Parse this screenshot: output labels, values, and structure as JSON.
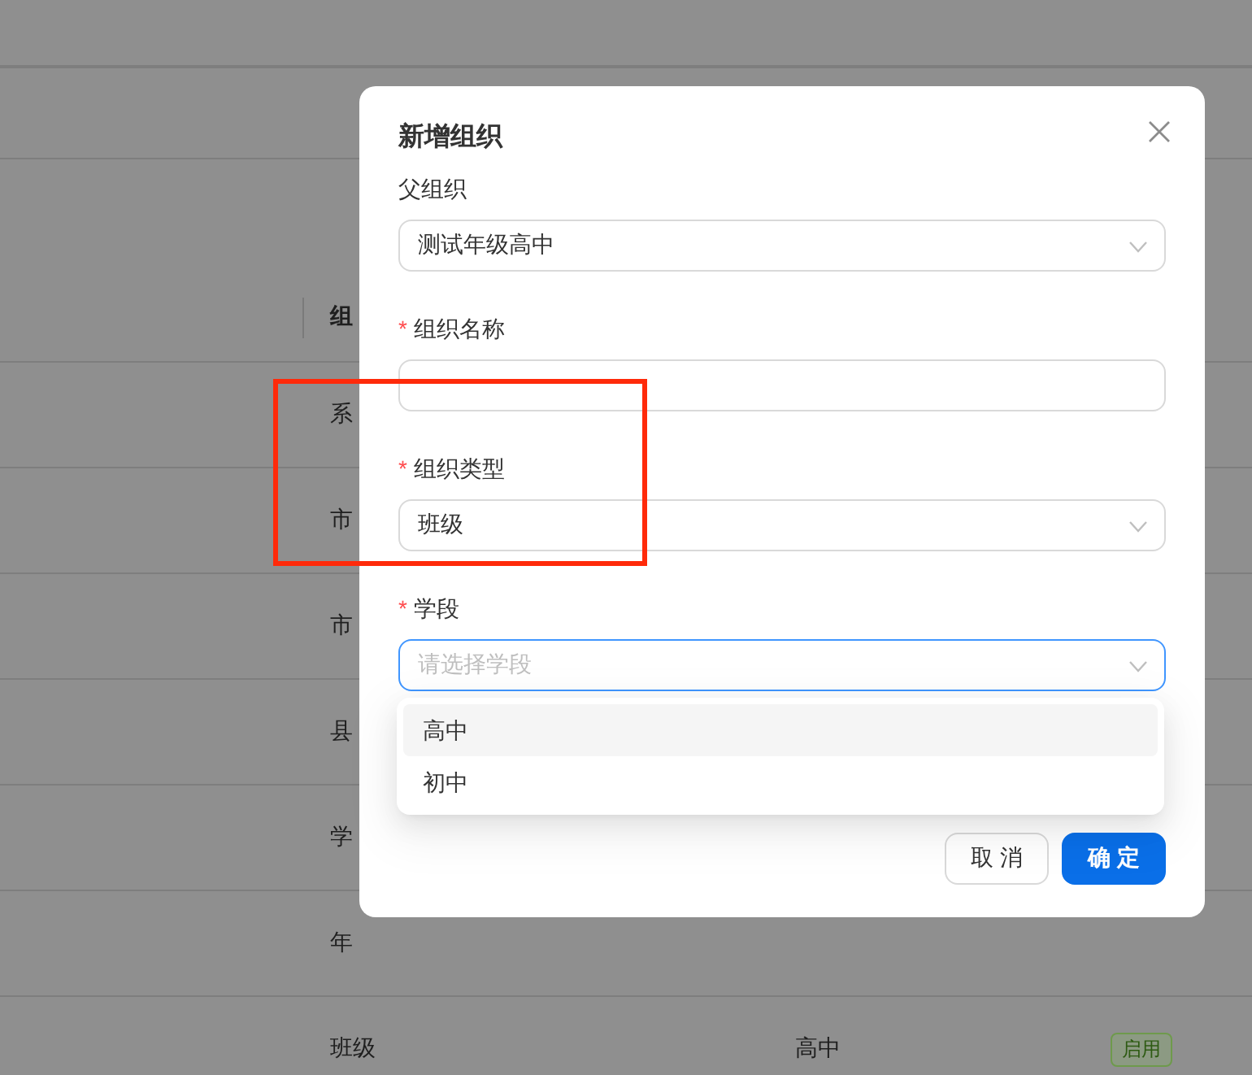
{
  "background_table": {
    "header": "组",
    "rows": [
      {
        "column_1": "系"
      },
      {
        "column_1": "市"
      },
      {
        "column_1": "市"
      },
      {
        "column_1": "县"
      },
      {
        "column_1": "学"
      },
      {
        "column_1": "年"
      },
      {
        "column_1": "班级",
        "column_2": "高中",
        "status": "启用"
      }
    ]
  },
  "dialog": {
    "title": "新增组织",
    "fields": [
      {
        "label": "父组织",
        "kind": "select",
        "value": "测试年级高中"
      },
      {
        "label": "组织名称",
        "required_mark": "*",
        "kind": "input"
      },
      {
        "label": "组织类型",
        "required_mark": "*",
        "kind": "select",
        "value": "班级"
      },
      {
        "label": "学段",
        "required_mark": "*",
        "kind": "select",
        "placeholder": "请选择学段",
        "focused": true
      }
    ],
    "dropdown": {
      "options": [
        {
          "label": "高中",
          "hovered": true
        },
        {
          "label": "初中",
          "hovered": false
        }
      ]
    },
    "buttons": [
      {
        "label": "取 消",
        "kind": "default"
      },
      {
        "label": "确 定",
        "kind": "primary"
      }
    ]
  },
  "annotation": {
    "kind": "box"
  }
}
